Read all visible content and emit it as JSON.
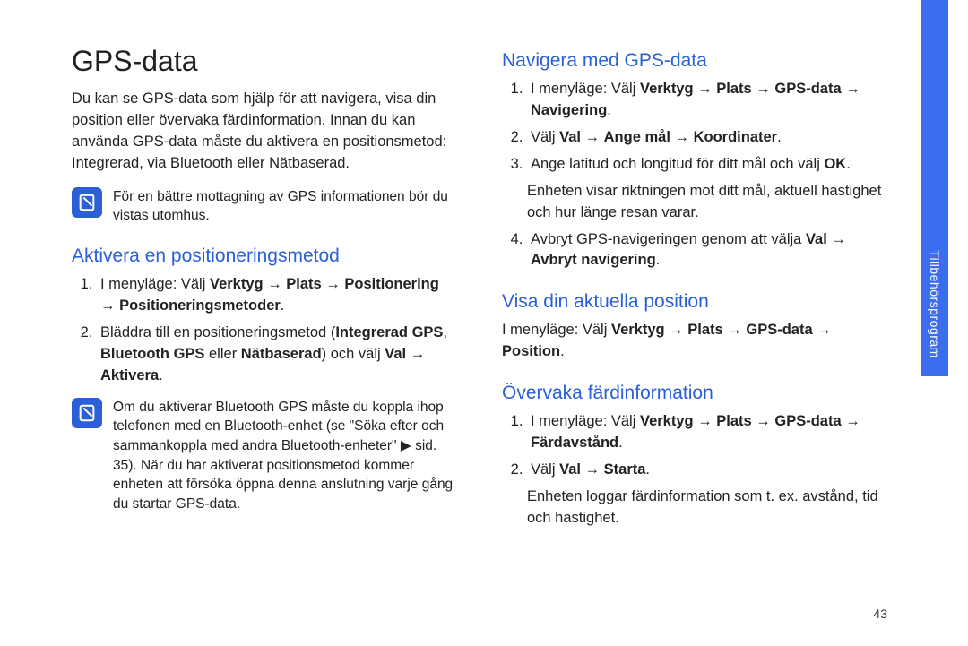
{
  "side_tab": "Tillbehörsprogram",
  "page_number": "43",
  "left": {
    "h1": "GPS-data",
    "intro": "Du kan se GPS-data som hjälp för att navigera, visa din position eller övervaka färdinformation. Innan du kan använda GPS-data måste du aktivera en positionsmetod: Integrerad, via Bluetooth eller Nätbaserad.",
    "note1": "För en bättre mottagning av GPS informationen bör du vistas utomhus.",
    "h2a": "Aktivera en positioneringsmetod",
    "a_step1_pre": "I menyläge: Välj ",
    "a_step1_b1": "Verktyg",
    "a_step1_b2": "Plats",
    "a_step1_b3": "Positionering",
    "a_step1_b4": "Positioneringsmetoder",
    "a_step2_pre": "Bläddra till en positioneringsmetod (",
    "a_step2_b1": "Integrerad GPS",
    "a_step2_mid1": ", ",
    "a_step2_b2": "Bluetooth GPS",
    "a_step2_mid2": " eller ",
    "a_step2_b3": "Nätbaserad",
    "a_step2_mid3": ") och välj ",
    "a_step2_b4": "Val",
    "a_step2_b5": "Aktivera",
    "note2": "Om du aktiverar Bluetooth GPS måste du koppla ihop telefonen med en Bluetooth-enhet (se \"Söka efter och sammankoppla med andra Bluetooth-enheter\" ▶ sid. 35). När du har aktiverat positionsmetod kommer enheten att försöka öppna denna anslutning varje gång du startar GPS-data."
  },
  "right": {
    "h2b": "Navigera med GPS-data",
    "b_step1_pre": "I menyläge: Välj ",
    "b_step1_b1": "Verktyg",
    "b_step1_b2": "Plats",
    "b_step1_b3": "GPS-data",
    "b_step1_b4": "Navigering",
    "b_step2_pre": "Välj ",
    "b_step2_b1": "Val",
    "b_step2_b2": "Ange mål",
    "b_step2_b3": "Koordinater",
    "b_step3_pre": "Ange latitud och longitud för ditt mål och välj ",
    "b_step3_b1": "OK",
    "b_step3_sub": "Enheten visar riktningen mot ditt mål, aktuell hastighet och hur länge resan varar.",
    "b_step4_pre": "Avbryt GPS-navigeringen genom att välja ",
    "b_step4_b1": "Val",
    "b_step4_b2": "Avbryt navigering",
    "h2c": "Visa din aktuella position",
    "c_line_pre": "I menyläge: Välj ",
    "c_line_b1": "Verktyg",
    "c_line_b2": "Plats",
    "c_line_b3": "GPS-data",
    "c_line_b4": "Position",
    "h2d": "Övervaka färdinformation",
    "d_step1_pre": "I menyläge: Välj ",
    "d_step1_b1": "Verktyg",
    "d_step1_b2": "Plats",
    "d_step1_b3": "GPS-data",
    "d_step1_b4": "Färdavstånd",
    "d_step2_pre": "Välj ",
    "d_step2_b1": "Val",
    "d_step2_b2": "Starta",
    "d_step2_sub": "Enheten loggar färdinformation som t. ex. avstånd, tid och hastighet."
  }
}
